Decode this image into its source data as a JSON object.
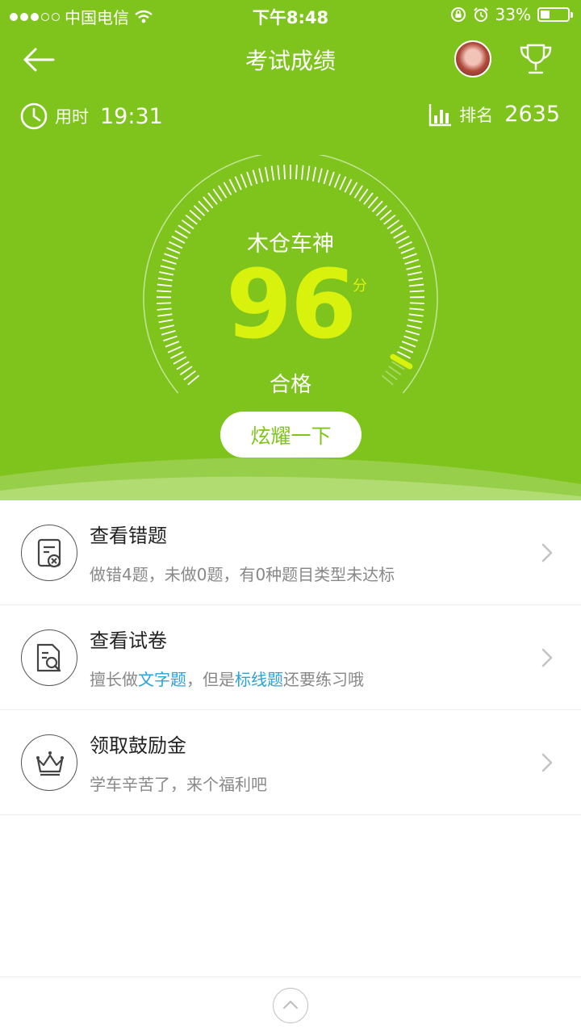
{
  "status_bar": {
    "carrier": "中国电信",
    "time": "下午8:48",
    "battery_text": "33%",
    "battery_level": 0.33
  },
  "nav": {
    "title": "考试成绩"
  },
  "stats": {
    "time_label": "用时",
    "time_value": "19:31",
    "rank_label": "排名",
    "rank_value": "2635"
  },
  "result": {
    "name": "木仓车神",
    "score": "96",
    "score_unit": "分",
    "status": "合格",
    "gauge_fraction": 0.96,
    "share_label": "炫耀一下"
  },
  "list": {
    "wrong": {
      "title": "查看错题",
      "subtitle": "做错4题，未做0题，有0种题目类型未达标"
    },
    "paper": {
      "title": "查看试卷",
      "sub_pre": "擅长做",
      "sub_hl1": "文字题",
      "sub_mid": "，但是",
      "sub_hl2": "标线题",
      "sub_post": "还要练习哦"
    },
    "reward": {
      "title": "领取鼓励金",
      "subtitle": "学车辛苦了，来个福利吧"
    }
  },
  "colors": {
    "primary_green": "#7fc41c",
    "score_yellow": "#d9f20d",
    "link_blue": "#27a3d9"
  },
  "icons": [
    "back-arrow-icon",
    "trophy-icon",
    "clock-icon",
    "bar-chart-icon",
    "wrong-questions-icon",
    "exam-paper-icon",
    "crown-icon",
    "chevron-right-icon",
    "chevron-up-icon"
  ]
}
